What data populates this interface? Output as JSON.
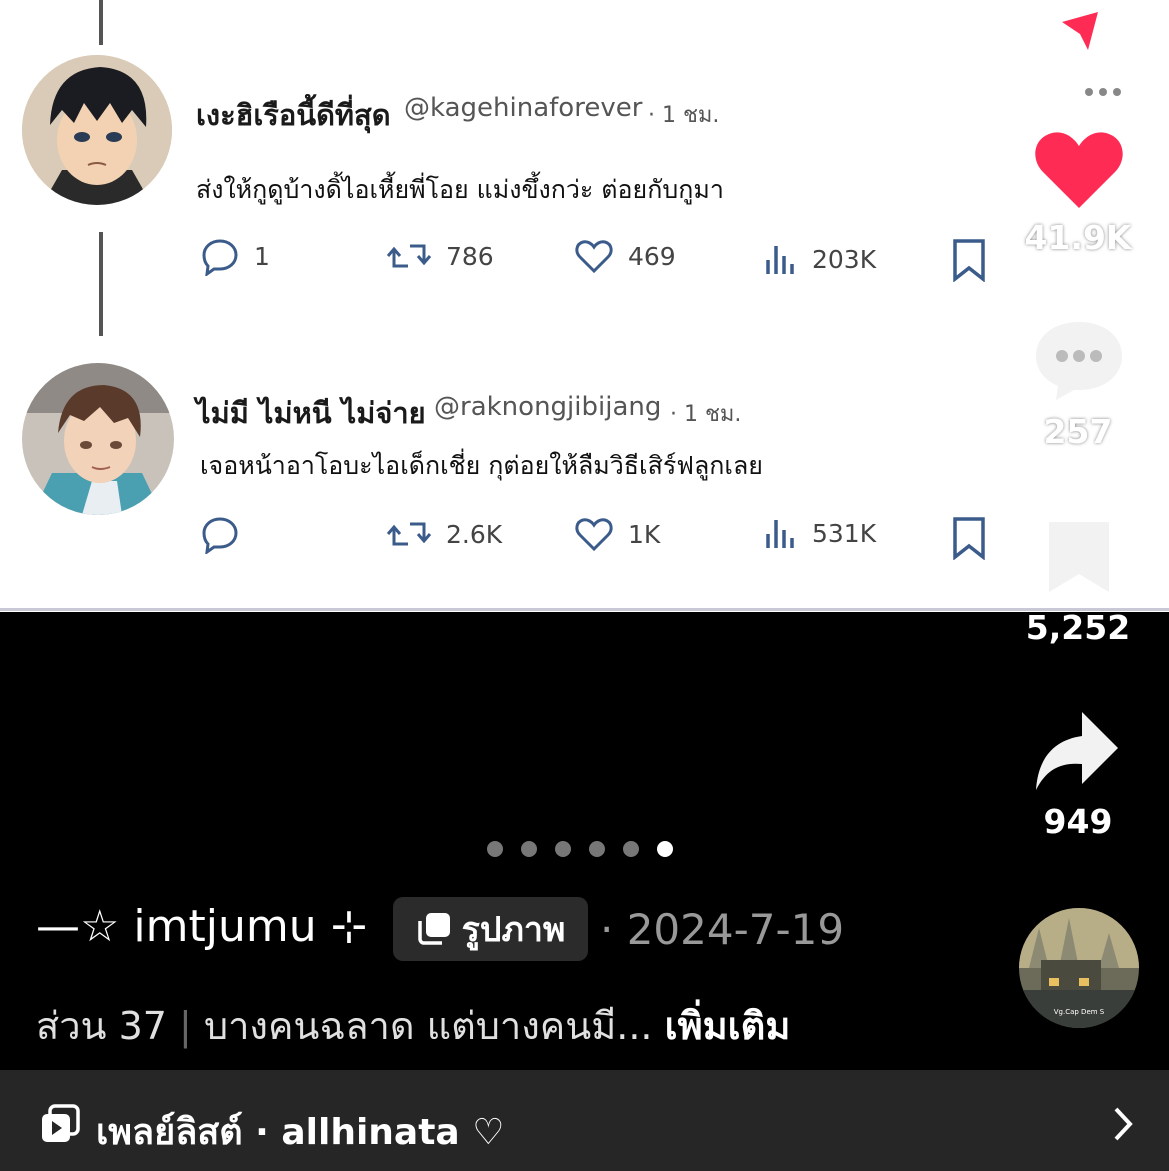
{
  "tweets": [
    {
      "name": "เงะฮิเรือนี้ดีที่สุด",
      "handle": "@kagehinaforever",
      "time": "· 1 ชม.",
      "body": "ส่งให้กูดูบ้างดิ้ไอเหี้ยพี่โอย แม่งขึ้งกว่ะ ต่อยกับกูมา",
      "replies": "1",
      "retweets": "786",
      "likes": "469",
      "views": "203K"
    },
    {
      "name": "ไม่มี ไม่หนี ไม่จ่าย",
      "handle": "@raknongjibijang",
      "time": "· 1 ชม.",
      "body": "เจอหน้าอาโอบะไอเด็กเชี่ย กุต่อยให้ลืมวิธีเสิร์ฟลูกเลย",
      "replies": "",
      "retweets": "2.6K",
      "likes": "1K",
      "views": "531K"
    }
  ],
  "sidebar": {
    "likes": "41.9K",
    "comments": "257",
    "saves": "5,252",
    "shares": "949",
    "profile_caption": "Vg.Cap Dem S"
  },
  "carousel": {
    "total": 6,
    "active": 6
  },
  "post": {
    "author": "—☆ imtjumu ⊹",
    "type_badge": "รูปภาพ",
    "date": "· 2024-7-19",
    "caption_part": "ส่วน 37",
    "caption_sep": "|",
    "caption_text": "บางคนฉลาด แต่บางคนมี...",
    "caption_more": "เพิ่มเติม"
  },
  "playlist": {
    "label": "เพลย์ลิสต์ · allhinata ♡"
  },
  "colors": {
    "heart": "#fe2c55",
    "send": "#fe2c55"
  }
}
